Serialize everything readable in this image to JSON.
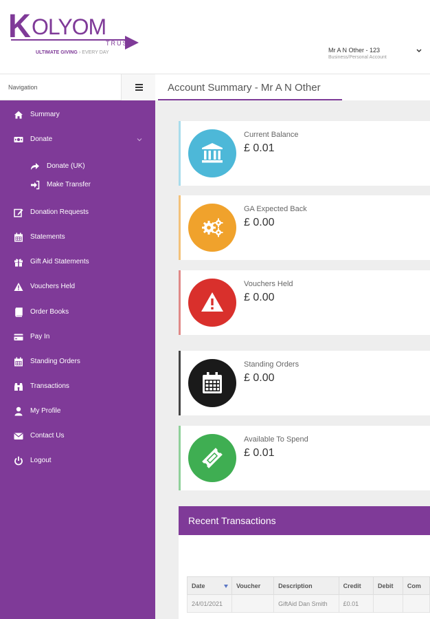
{
  "logo": {
    "name": "KOLYOM",
    "subname": "TRUST",
    "tagline": "ULTIMATE GIVING",
    "tagline_suffix": "EVERY DAY"
  },
  "user": {
    "name": "Mr A N Other - 123",
    "account_type": "Business/Personal Account",
    "caret_icon": "chevron-down-icon"
  },
  "nav_header": {
    "label": "Navigation",
    "toggle_icon": "hamburger-icon"
  },
  "page": {
    "title": "Account Summary - Mr A N Other"
  },
  "sidebar": {
    "items": [
      {
        "label": "Summary",
        "icon": "home-icon"
      },
      {
        "label": "Donate",
        "icon": "money-icon",
        "expanded": true
      },
      {
        "label": "Donate (UK)",
        "icon": "share-arrow-icon",
        "sub": true
      },
      {
        "label": "Make Transfer",
        "icon": "sign-in-icon",
        "sub": true
      },
      {
        "label": "Donation Requests",
        "icon": "edit-icon"
      },
      {
        "label": "Statements",
        "icon": "calendar-icon"
      },
      {
        "label": "Gift Aid Statements",
        "icon": "gift-icon"
      },
      {
        "label": "Vouchers Held",
        "icon": "warning-icon"
      },
      {
        "label": "Order Books",
        "icon": "book-icon"
      },
      {
        "label": "Pay In",
        "icon": "credit-card-icon"
      },
      {
        "label": "Standing Orders",
        "icon": "calendar-icon"
      },
      {
        "label": "Transactions",
        "icon": "binoculars-icon"
      },
      {
        "label": "My Profile",
        "icon": "user-icon"
      },
      {
        "label": "Contact Us",
        "icon": "envelope-icon"
      },
      {
        "label": "Logout",
        "icon": "power-icon"
      }
    ]
  },
  "cards": [
    {
      "label": "Current Balance",
      "value": "£ 0.01",
      "color": "#4db8d8",
      "accent": "#a9dcec",
      "icon": "bank-icon"
    },
    {
      "label": "GA Expected Back",
      "value": "£ 0.00",
      "color": "#f0a22c",
      "accent": "#f3c27a",
      "icon": "gears-icon"
    },
    {
      "label": "Vouchers Held",
      "value": "£ 0.00",
      "color": "#d9302c",
      "accent": "#e08a88",
      "icon": "warning-icon"
    },
    {
      "label": "Standing Orders",
      "value": "£ 0.00",
      "color": "#1a1a1a",
      "accent": "#444444",
      "icon": "calendar-icon"
    },
    {
      "label": "Available To Spend",
      "value": "£ 0.01",
      "color": "#3fae52",
      "accent": "#8fd09a",
      "icon": "ticket-icon"
    }
  ],
  "recent": {
    "title": "Recent Transactions",
    "columns": [
      "Date",
      "Voucher",
      "Description",
      "Credit",
      "Debit",
      "Com"
    ],
    "rows": [
      [
        "24/01/2021",
        "",
        "GiftAid Dan Smith",
        "£0.01",
        "",
        ""
      ]
    ]
  },
  "colors": {
    "brand_purple": "#7f3a98",
    "content_bg": "#eeeeee"
  }
}
